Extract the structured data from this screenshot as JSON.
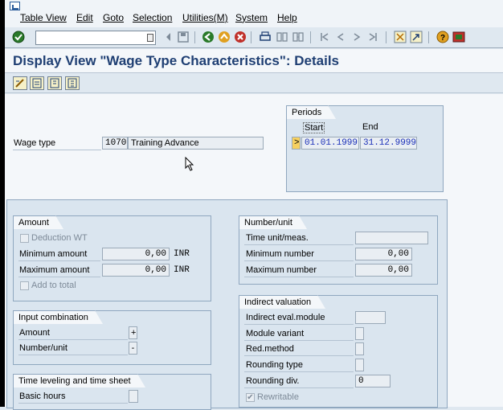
{
  "menu": [
    "Table View",
    "Edit",
    "Goto",
    "Selection",
    "Utilities(M)",
    "System",
    "Help"
  ],
  "title": "Display View \"Wage Type Characteristics\": Details",
  "periods": {
    "header": "Periods",
    "start_label": "Start",
    "end_label": "End",
    "start": "01.01.1999",
    "end": "31.12.9999"
  },
  "wage_type": {
    "label": "Wage type",
    "code": "1070",
    "name": "Training Advance"
  },
  "amount": {
    "header": "Amount",
    "deduction_wt": "Deduction WT",
    "min_label": "Minimum amount",
    "min_value": "0,00",
    "min_cur": "INR",
    "max_label": "Maximum amount",
    "max_value": "0,00",
    "max_cur": "INR",
    "add_to_total": "Add to total"
  },
  "number_unit": {
    "header": "Number/unit",
    "time_unit_label": "Time unit/meas.",
    "min_label": "Minimum number",
    "min_value": "0,00",
    "max_label": "Maximum number",
    "max_value": "0,00"
  },
  "input_comb": {
    "header": "Input combination",
    "amount_label": "Amount",
    "amount_val": "+",
    "number_label": "Number/unit",
    "number_val": "-"
  },
  "indirect": {
    "header": "Indirect valuation",
    "module_label": "Indirect eval.module",
    "variant_label": "Module variant",
    "red_label": "Red.method",
    "round_type_label": "Rounding type",
    "round_div_label": "Rounding div.",
    "round_div_value": "0",
    "rewritable": "Rewritable"
  },
  "time_leveling": {
    "header": "Time leveling and time sheet",
    "basic_hours": "Basic hours"
  }
}
